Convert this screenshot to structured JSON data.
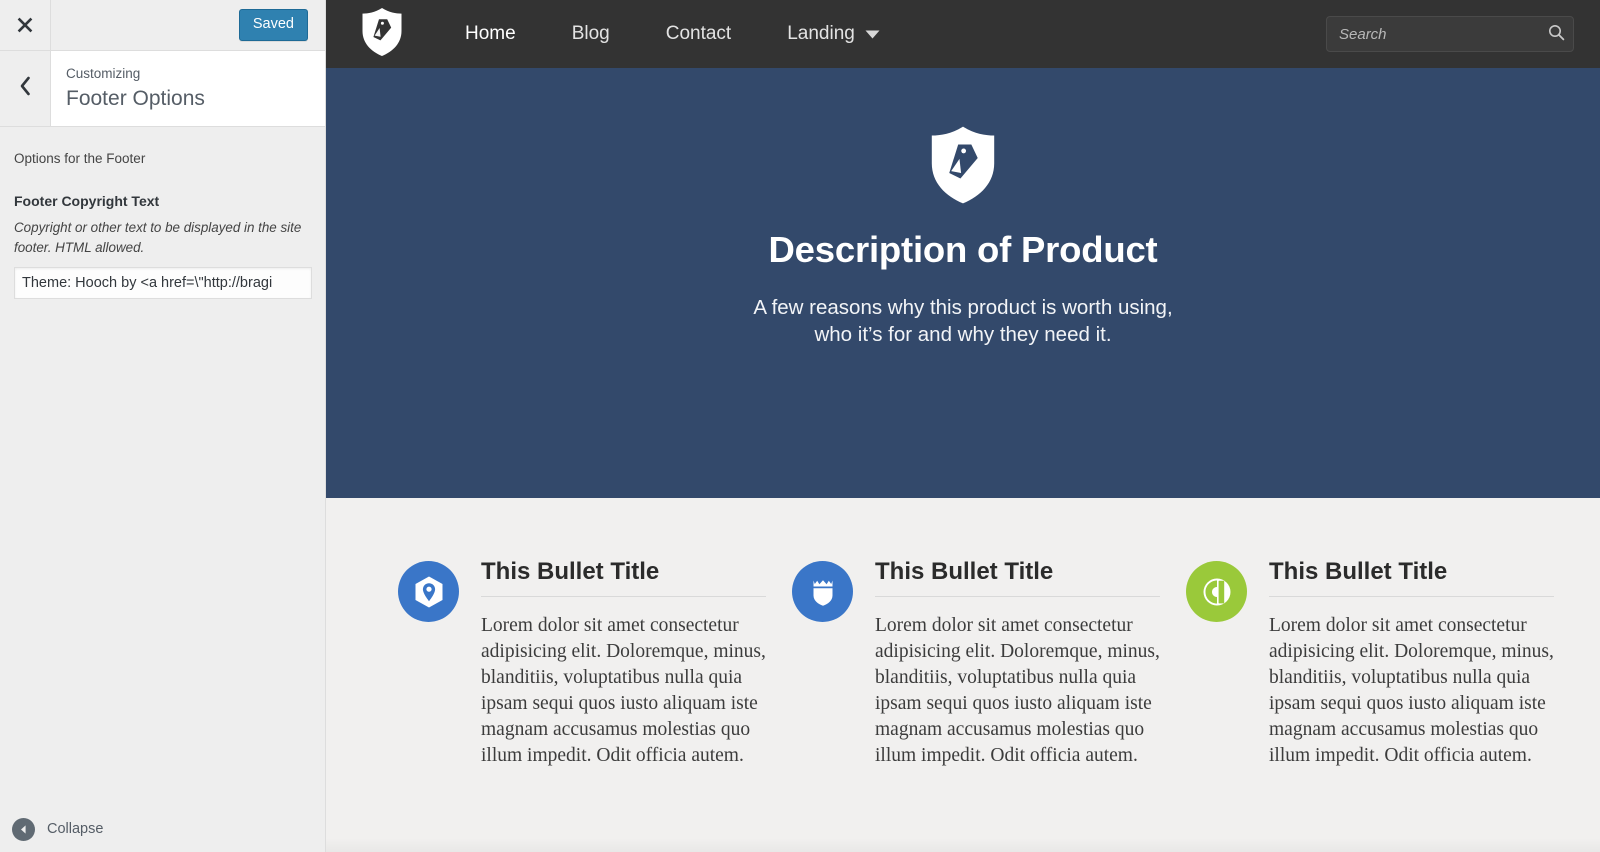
{
  "customizer": {
    "close_icon": "close-x-icon",
    "save_button_label": "Saved",
    "back_icon": "chevron-left-icon",
    "eyebrow": "Customizing",
    "panel_title": "Footer Options",
    "section_description": "Options for the Footer",
    "field": {
      "label": "Footer Copyright Text",
      "description": "Copyright or other text to be displayed in the site footer. HTML allowed.",
      "value": "Theme: Hooch by <a href=\\\"http://bragi",
      "placeholder": ""
    },
    "collapse_label": "Collapse",
    "collapse_icon": "collapse-arrow-left-icon"
  },
  "preview": {
    "nav": {
      "logo_icon": "shield-tag-logo-icon",
      "links": [
        {
          "label": "Home",
          "active": true,
          "has_caret": false
        },
        {
          "label": "Blog",
          "active": false,
          "has_caret": false
        },
        {
          "label": "Contact",
          "active": false,
          "has_caret": false
        },
        {
          "label": "Landing",
          "active": false,
          "has_caret": true
        }
      ],
      "search": {
        "placeholder": "Search",
        "value": "",
        "icon": "search-icon"
      }
    },
    "hero": {
      "logo_icon": "shield-tag-logo-icon",
      "title": "Description of Product",
      "subtitle_line1": "A few reasons why this product is worth using,",
      "subtitle_line2": "who it’s for and why they need it."
    },
    "bullets": [
      {
        "icon": "map-pin-hexagon-icon",
        "icon_color": "#3a76c8",
        "title": "This Bullet Title",
        "body": "Lorem dolor sit amet consectetur adipisicing elit. Doloremque, minus, blanditiis, voluptatibus nulla quia ipsam sequi quos iusto aliquam iste magnam accusamus molestias quo illum impedit. Odit officia autem."
      },
      {
        "icon": "police-badge-icon",
        "icon_color": "#3a76c8",
        "title": "This Bullet Title",
        "body": "Lorem dolor sit amet consectetur adipisicing elit. Doloremque, minus, blanditiis, voluptatibus nulla quia ipsam sequi quos iusto aliquam iste magnam accusamus molestias quo illum impedit. Odit officia autem."
      },
      {
        "icon": "ring-shape-icon",
        "icon_color": "#9ac93a",
        "title": "This Bullet Title",
        "body": "Lorem dolor sit amet consectetur adipisicing elit. Doloremque, minus, blanditiis, voluptatibus nulla quia ipsam sequi quos iusto aliquam iste magnam accusamus molestias quo illum impedit. Odit officia autem."
      }
    ]
  },
  "colors": {
    "hero_bg": "#33496b",
    "nav_bg": "#333333",
    "page_bg": "#f1f0ef",
    "accent_blue": "#3a76c8",
    "accent_green": "#9ac93a",
    "save_button": "#2f81b0"
  }
}
